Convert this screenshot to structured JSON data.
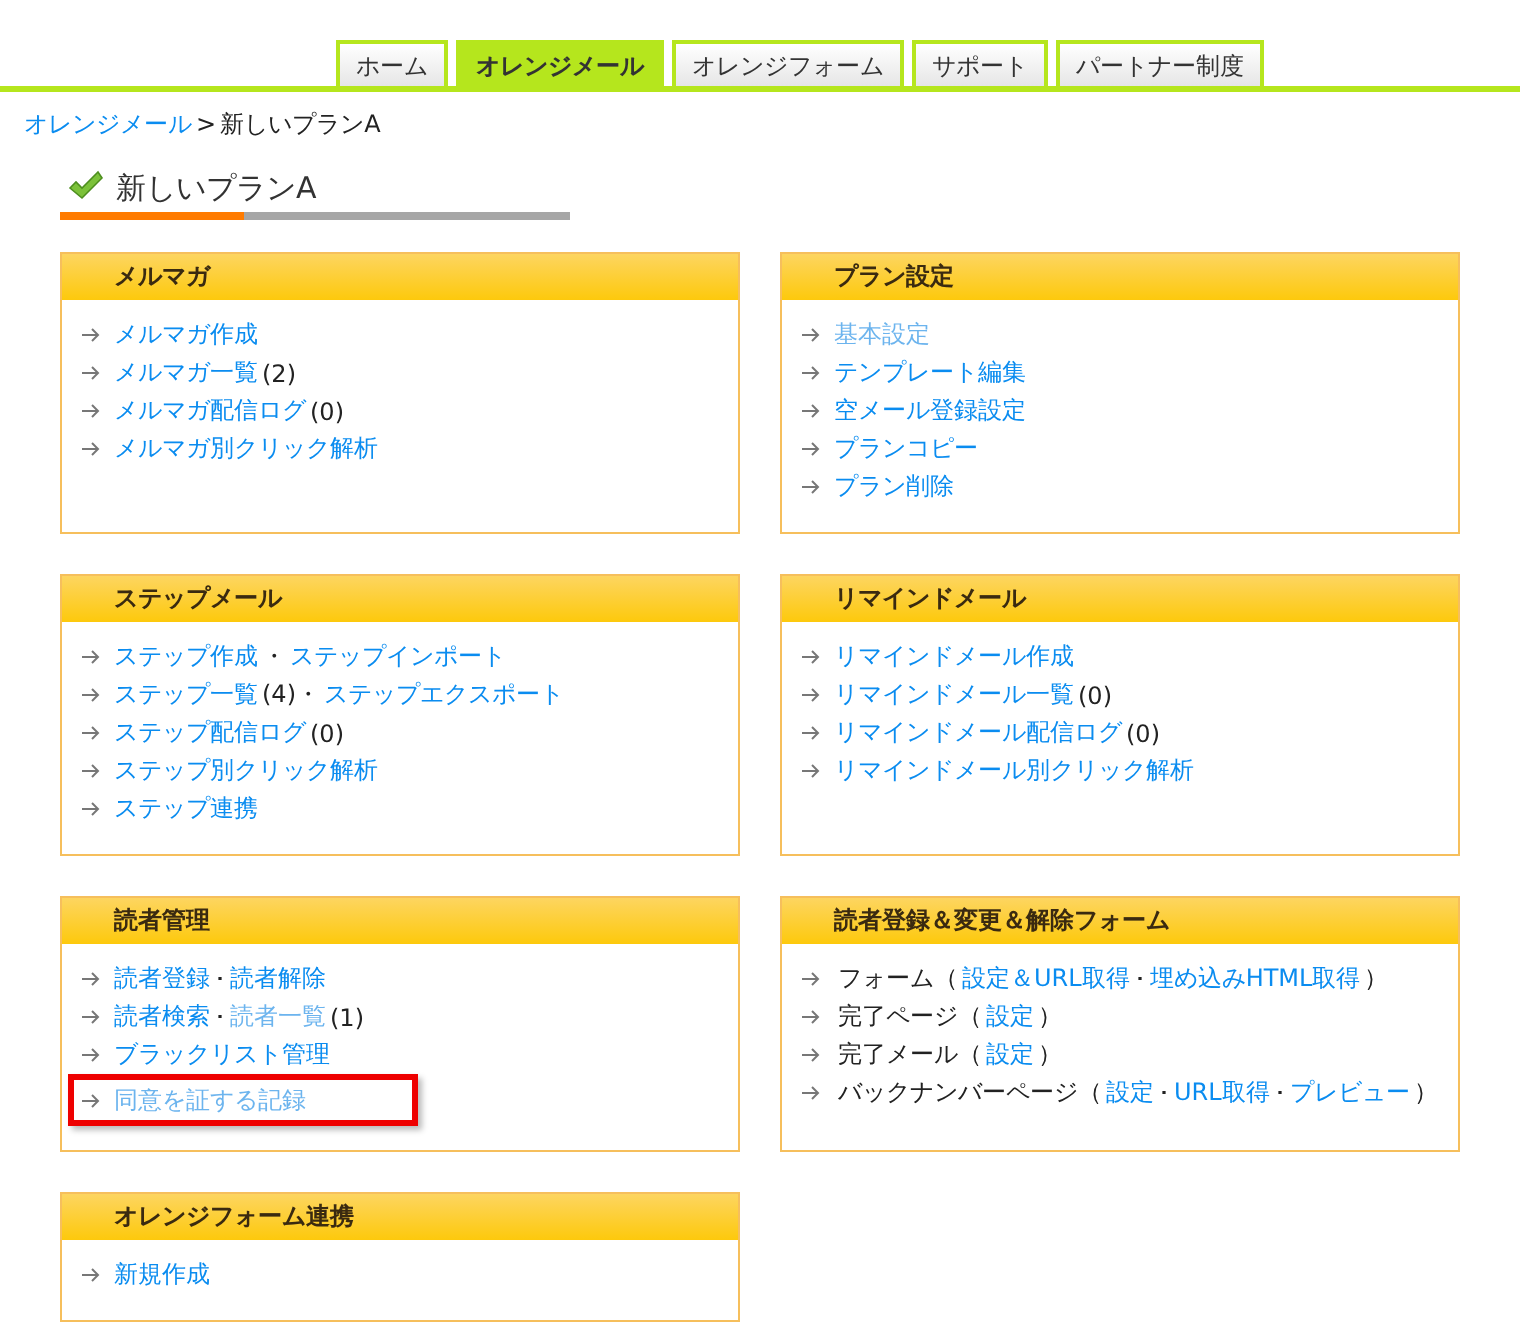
{
  "tabs": [
    {
      "label": "ホーム",
      "selected": false
    },
    {
      "label": "オレンジメール",
      "selected": true
    },
    {
      "label": "オレンジフォーム",
      "selected": false
    },
    {
      "label": "サポート",
      "selected": false
    },
    {
      "label": "パートナー制度",
      "selected": false
    }
  ],
  "breadcrumb": {
    "link": "オレンジメール",
    "separator": ">",
    "current": "新しいプランA"
  },
  "page_title": "新しいプランA",
  "panels": [
    {
      "title": "メルマガ",
      "items": [
        {
          "highlighted": false,
          "segments": [
            {
              "kind": "link",
              "text": "メルマガ作成",
              "visited": false
            }
          ]
        },
        {
          "highlighted": false,
          "segments": [
            {
              "kind": "link",
              "text": "メルマガ一覧",
              "visited": false
            },
            {
              "kind": "plain",
              "text": "(2)"
            }
          ]
        },
        {
          "highlighted": false,
          "segments": [
            {
              "kind": "link",
              "text": "メルマガ配信ログ",
              "visited": false
            },
            {
              "kind": "plain",
              "text": "(0)"
            }
          ]
        },
        {
          "highlighted": false,
          "segments": [
            {
              "kind": "link",
              "text": "メルマガ別クリック解析",
              "visited": false
            }
          ]
        }
      ]
    },
    {
      "title": "プラン設定",
      "items": [
        {
          "highlighted": false,
          "segments": [
            {
              "kind": "link",
              "text": "基本設定",
              "visited": true
            }
          ]
        },
        {
          "highlighted": false,
          "segments": [
            {
              "kind": "link",
              "text": "テンプレート編集",
              "visited": false
            }
          ]
        },
        {
          "highlighted": false,
          "segments": [
            {
              "kind": "link",
              "text": "空メール登録設定",
              "visited": false
            }
          ]
        },
        {
          "highlighted": false,
          "segments": [
            {
              "kind": "link",
              "text": "プランコピー",
              "visited": false
            }
          ]
        },
        {
          "highlighted": false,
          "segments": [
            {
              "kind": "link",
              "text": "プラン削除",
              "visited": false
            }
          ]
        }
      ]
    },
    {
      "title": "ステップメール",
      "items": [
        {
          "highlighted": false,
          "segments": [
            {
              "kind": "link",
              "text": "ステップ作成",
              "visited": false
            },
            {
              "kind": "plain",
              "text": "・"
            },
            {
              "kind": "link",
              "text": "ステップインポート",
              "visited": false
            }
          ]
        },
        {
          "highlighted": false,
          "segments": [
            {
              "kind": "link",
              "text": "ステップ一覧",
              "visited": false
            },
            {
              "kind": "plain",
              "text": "(4)・"
            },
            {
              "kind": "link",
              "text": "ステップエクスポート",
              "visited": false
            }
          ]
        },
        {
          "highlighted": false,
          "segments": [
            {
              "kind": "link",
              "text": "ステップ配信ログ",
              "visited": false
            },
            {
              "kind": "plain",
              "text": "(0)"
            }
          ]
        },
        {
          "highlighted": false,
          "segments": [
            {
              "kind": "link",
              "text": "ステップ別クリック解析",
              "visited": false
            }
          ]
        },
        {
          "highlighted": false,
          "segments": [
            {
              "kind": "link",
              "text": "ステップ連携",
              "visited": false
            }
          ]
        }
      ]
    },
    {
      "title": "リマインドメール",
      "items": [
        {
          "highlighted": false,
          "segments": [
            {
              "kind": "link",
              "text": "リマインドメール作成",
              "visited": false
            }
          ]
        },
        {
          "highlighted": false,
          "segments": [
            {
              "kind": "link",
              "text": "リマインドメール一覧",
              "visited": false
            },
            {
              "kind": "plain",
              "text": "(0)"
            }
          ]
        },
        {
          "highlighted": false,
          "segments": [
            {
              "kind": "link",
              "text": "リマインドメール配信ログ",
              "visited": false
            },
            {
              "kind": "plain",
              "text": "(0)"
            }
          ]
        },
        {
          "highlighted": false,
          "segments": [
            {
              "kind": "link",
              "text": "リマインドメール別クリック解析",
              "visited": false
            }
          ]
        }
      ]
    },
    {
      "title": "読者管理",
      "items": [
        {
          "highlighted": false,
          "segments": [
            {
              "kind": "link",
              "text": "読者登録",
              "visited": false
            },
            {
              "kind": "plain",
              "text": "･"
            },
            {
              "kind": "link",
              "text": "読者解除",
              "visited": false
            }
          ]
        },
        {
          "highlighted": false,
          "segments": [
            {
              "kind": "link",
              "text": "読者検索",
              "visited": false
            },
            {
              "kind": "plain",
              "text": "･"
            },
            {
              "kind": "link",
              "text": "読者一覧",
              "visited": true
            },
            {
              "kind": "plain",
              "text": "(1)"
            }
          ]
        },
        {
          "highlighted": false,
          "segments": [
            {
              "kind": "link",
              "text": "ブラックリスト管理",
              "visited": false
            }
          ]
        },
        {
          "highlighted": true,
          "segments": [
            {
              "kind": "link",
              "text": "同意を証する記録",
              "visited": true
            }
          ]
        }
      ]
    },
    {
      "title": "読者登録＆変更＆解除フォーム",
      "items": [
        {
          "highlighted": false,
          "segments": [
            {
              "kind": "plain",
              "text": "フォーム（"
            },
            {
              "kind": "link",
              "text": "設定＆URL取得",
              "visited": false
            },
            {
              "kind": "plain",
              "text": "･"
            },
            {
              "kind": "link",
              "text": "埋め込みHTML取得",
              "visited": false
            },
            {
              "kind": "plain",
              "text": "）"
            }
          ]
        },
        {
          "highlighted": false,
          "segments": [
            {
              "kind": "plain",
              "text": "完了ページ（"
            },
            {
              "kind": "link",
              "text": "設定",
              "visited": false
            },
            {
              "kind": "plain",
              "text": "）"
            }
          ]
        },
        {
          "highlighted": false,
          "segments": [
            {
              "kind": "plain",
              "text": "完了メール（"
            },
            {
              "kind": "link",
              "text": "設定",
              "visited": false
            },
            {
              "kind": "plain",
              "text": "）"
            }
          ]
        },
        {
          "highlighted": false,
          "segments": [
            {
              "kind": "plain",
              "text": "バックナンバーページ（"
            },
            {
              "kind": "link",
              "text": "設定",
              "visited": false
            },
            {
              "kind": "plain",
              "text": "･"
            },
            {
              "kind": "link",
              "text": "URL取得",
              "visited": false
            },
            {
              "kind": "plain",
              "text": "･"
            },
            {
              "kind": "link",
              "text": "プレビュー",
              "visited": false
            },
            {
              "kind": "plain",
              "text": "）"
            }
          ]
        }
      ]
    },
    {
      "title": "オレンジフォーム連携",
      "items": [
        {
          "highlighted": false,
          "segments": [
            {
              "kind": "link",
              "text": "新規作成",
              "visited": false
            }
          ]
        }
      ]
    }
  ]
}
